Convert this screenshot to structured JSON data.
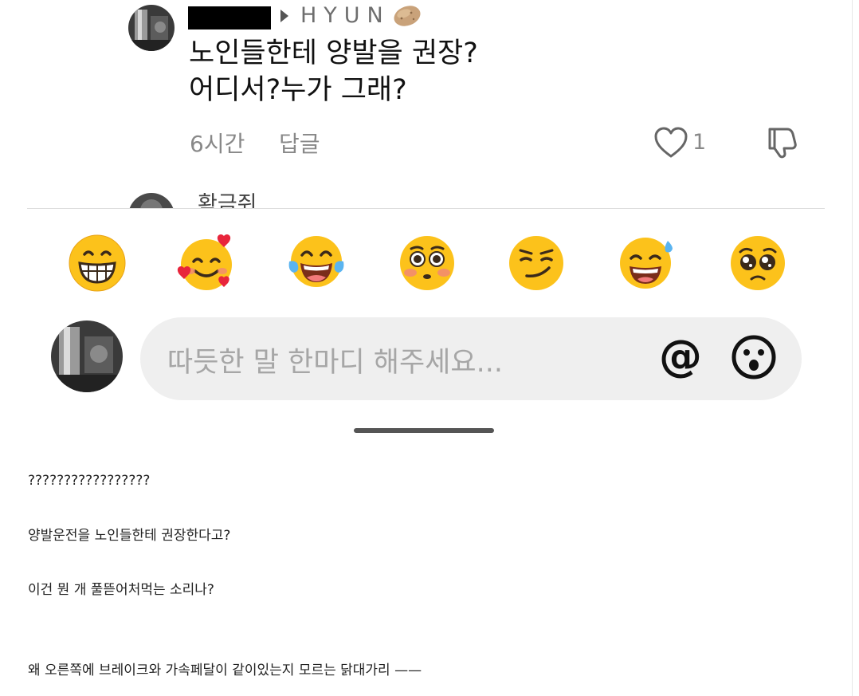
{
  "comment": {
    "username": "HYUN",
    "text_line1": "노인들한테 양발을 권장?",
    "text_line2": "어디서?누가 그래?",
    "time": "6시간",
    "reply_label": "답글",
    "like_count": "1"
  },
  "next_comment": {
    "username": "확금쥐"
  },
  "emoji_bar": {
    "emojis": [
      "grinning-face",
      "smiling-face-with-hearts",
      "face-with-tears-of-joy",
      "flushed-face",
      "smirking-face",
      "grinning-face-with-sweat",
      "pleading-face"
    ]
  },
  "input": {
    "placeholder": "따듯한 말 한마디 해주세요...",
    "mention_icon": "at-sign-icon",
    "emoji_icon": "surprised-face-icon"
  },
  "article": {
    "line1": "?????????????????",
    "line2": "양발운전을 노인들한테 권장한다고?",
    "line3": "이건 뭔 개 풀뜯어처먹는 소리나?",
    "line4": "왜 오른쪽에 브레이크와 가속페달이 같이있는지 모르는 닭대가리 ——"
  }
}
